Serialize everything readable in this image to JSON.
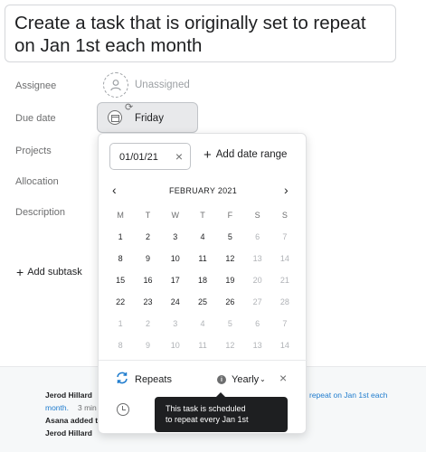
{
  "task": {
    "title": "Create a task that is originally set to repeat on Jan 1st each month"
  },
  "fields": {
    "assignee_label": "Assignee",
    "assignee_value": "Unassigned",
    "due_label": "Due date",
    "due_value": "Friday",
    "projects_label": "Projects",
    "allocation_label": "Allocation",
    "description_label": "Description",
    "add_subtask": "Add subtask"
  },
  "date_picker": {
    "date_value": "01/01/21",
    "add_range": "Add date range",
    "month": "FEBRUARY 2021",
    "weekdays": [
      "M",
      "T",
      "W",
      "T",
      "F",
      "S",
      "S"
    ],
    "weeks": [
      [
        [
          "1",
          false
        ],
        [
          "2",
          false
        ],
        [
          "3",
          false
        ],
        [
          "4",
          false
        ],
        [
          "5",
          false
        ],
        [
          "6",
          true
        ],
        [
          "7",
          true
        ]
      ],
      [
        [
          "8",
          false
        ],
        [
          "9",
          false
        ],
        [
          "10",
          false
        ],
        [
          "11",
          false
        ],
        [
          "12",
          false
        ],
        [
          "13",
          true
        ],
        [
          "14",
          true
        ]
      ],
      [
        [
          "15",
          false
        ],
        [
          "16",
          false
        ],
        [
          "17",
          false
        ],
        [
          "18",
          false
        ],
        [
          "19",
          false
        ],
        [
          "20",
          true
        ],
        [
          "21",
          true
        ]
      ],
      [
        [
          "22",
          false
        ],
        [
          "23",
          false
        ],
        [
          "24",
          false
        ],
        [
          "25",
          false
        ],
        [
          "26",
          false
        ],
        [
          "27",
          true
        ],
        [
          "28",
          true
        ]
      ],
      [
        [
          "1",
          true
        ],
        [
          "2",
          true
        ],
        [
          "3",
          true
        ],
        [
          "4",
          true
        ],
        [
          "5",
          true
        ],
        [
          "6",
          true
        ],
        [
          "7",
          true
        ]
      ],
      [
        [
          "8",
          true
        ],
        [
          "9",
          true
        ],
        [
          "10",
          true
        ],
        [
          "11",
          true
        ],
        [
          "12",
          true
        ],
        [
          "13",
          true
        ],
        [
          "14",
          true
        ]
      ]
    ],
    "repeats_label": "Repeats",
    "frequency": "Yearly"
  },
  "tooltip": {
    "line1": "This task is scheduled",
    "line2": "to repeat every Jan 1st"
  },
  "activity": {
    "line1_user": "Jerod Hillard",
    "line1_link": "repeat on Jan 1st each",
    "line2_link": "month.",
    "line2_time": "3 min",
    "line3": "Asana added t",
    "line4_user": "Jerod Hillard"
  },
  "colors": {
    "accent": "#1f7cce",
    "tooltip_bg": "#1e1f21",
    "activity_bg": "#f6f8f9"
  },
  "icons": {
    "assignee": "user-icon",
    "due": "calendar-icon",
    "due_badge": "repeat-icon",
    "clear": "close-icon",
    "prev": "chevron-left-icon",
    "next": "chevron-right-icon",
    "repeats": "repeat-icon",
    "info": "info-icon",
    "time": "clock-icon"
  }
}
